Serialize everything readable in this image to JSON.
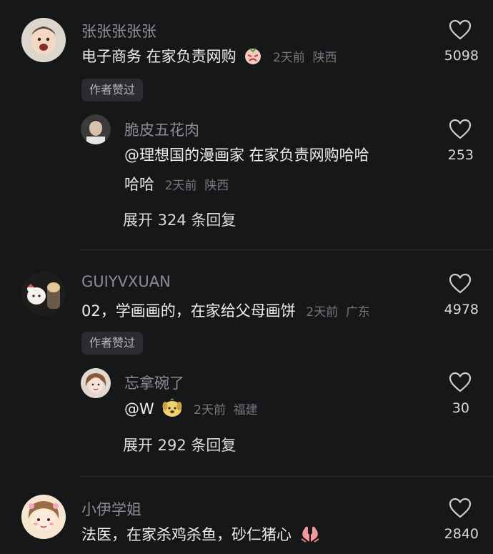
{
  "comments": [
    {
      "name": "张张张张张",
      "text": "电子商务 在家负责网购",
      "time": "2天前",
      "location": "陕西",
      "likes": "5098",
      "badge": "作者赞过",
      "reply": {
        "name": "脆皮五花肉",
        "text_line1": "@理想国的漫画家 在家负责网购哈哈",
        "text_line2": "哈哈",
        "time": "2天前",
        "location": "陕西",
        "likes": "253"
      },
      "expand": "展开 324 条回复"
    },
    {
      "name": "GUIYVXUAN",
      "text": "02，学画画的，在家给父母画饼",
      "time": "2天前",
      "location": "广东",
      "likes": "4978",
      "badge": "作者赞过",
      "reply": {
        "name": "忘拿碗了",
        "text_line1": "@W",
        "time": "2天前",
        "location": "福建",
        "likes": "30"
      },
      "expand": "展开 292 条回复"
    },
    {
      "name": "小伊学姐",
      "text": "法医，在家杀鸡杀鱼，砂仁猪心",
      "likes": "2840"
    }
  ],
  "icons": {
    "like": "heart-outline-icon",
    "emoji_1": "angry-face-emoji",
    "emoji_2": "puppy-face-emoji",
    "emoji_3": "praying-hands-emoji"
  }
}
